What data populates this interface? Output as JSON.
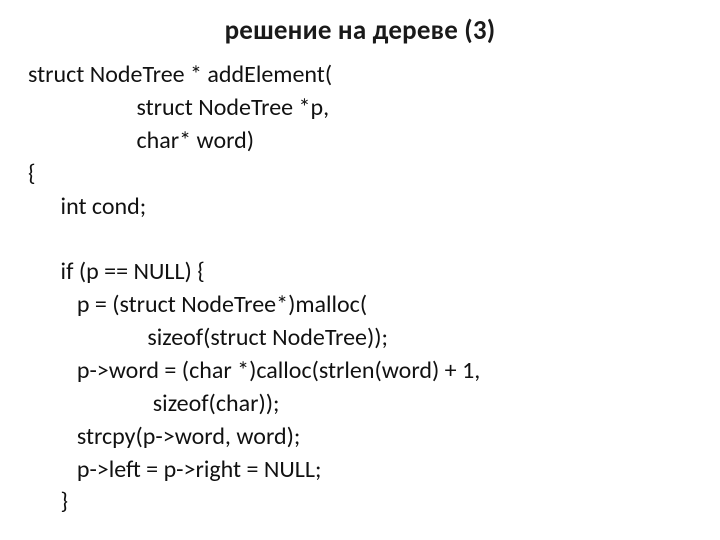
{
  "title": "решение на дереве (3)",
  "code": {
    "l1": "struct NodeTree * addElement(",
    "l2": "                    struct NodeTree *p,",
    "l3": "                    char* word)",
    "l4": "{",
    "l5": "      int cond;",
    "l6": "",
    "l7": "      if (p == NULL) {",
    "l8": "         p = (struct NodeTree*)malloc(",
    "l9": "                      sizeof(struct NodeTree));",
    "l10": "         p->word = (char *)calloc(strlen(word) + 1,",
    "l11": "                       sizeof(char));",
    "l12": "         strcpy(p->word, word);",
    "l13": "         p->left = p->right = NULL;",
    "l14": "      }"
  }
}
